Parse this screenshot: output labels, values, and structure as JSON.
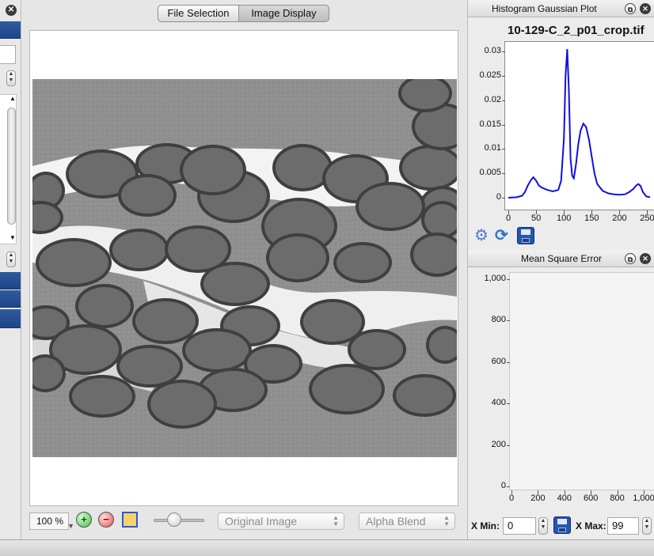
{
  "tabs": {
    "file_selection": "File Selection",
    "image_display": "Image Display"
  },
  "image_controls": {
    "zoom_value": "100 %",
    "display_mode": "Original Image",
    "blend_mode": "Alpha Blend",
    "opacity_slider": 0.4
  },
  "histogram_panel": {
    "header": "Histogram  Gaussian Plot",
    "chart_title": "10-129-C_2_p01_crop.tif"
  },
  "mse_panel": {
    "header": "Mean Square Error",
    "x_min_label": "X Min:",
    "x_min_value": "0",
    "x_max_label": "X Max:",
    "x_max_value": "99"
  },
  "chart_data": [
    {
      "type": "line",
      "title": "10-129-C_2_p01_crop.tif",
      "x_ticks": [
        "0",
        "50",
        "100",
        "150",
        "200",
        "250"
      ],
      "y_ticks": [
        "0",
        "0.005",
        "0.01",
        "0.015",
        "0.02",
        "0.025",
        "0.03"
      ],
      "xlim": [
        0,
        255
      ],
      "ylim": [
        0,
        0.031
      ],
      "series": [
        {
          "color": "#1010e0",
          "x": [
            0,
            15,
            25,
            30,
            35,
            40,
            45,
            50,
            55,
            60,
            70,
            80,
            90,
            95,
            100,
            103,
            106,
            109,
            112,
            115,
            118,
            122,
            126,
            130,
            135,
            140,
            145,
            150,
            155,
            160,
            170,
            180,
            190,
            200,
            210,
            218,
            225,
            230,
            234,
            238,
            242,
            248,
            255
          ],
          "y": [
            0,
            0.0001,
            0.0004,
            0.0012,
            0.0025,
            0.0035,
            0.0042,
            0.0035,
            0.0025,
            0.0021,
            0.0016,
            0.0013,
            0.0016,
            0.0035,
            0.012,
            0.025,
            0.0305,
            0.022,
            0.008,
            0.0045,
            0.004,
            0.007,
            0.011,
            0.0138,
            0.0152,
            0.0145,
            0.012,
            0.0085,
            0.005,
            0.0028,
            0.0014,
            0.0009,
            0.0007,
            0.0006,
            0.0007,
            0.0012,
            0.0018,
            0.0025,
            0.0028,
            0.0024,
            0.0012,
            0.0003,
            0.0001
          ]
        }
      ],
      "grid": false,
      "legend": "none"
    },
    {
      "type": "line",
      "title": "",
      "x_ticks": [
        "0",
        "200",
        "400",
        "600",
        "800",
        "1,000"
      ],
      "y_ticks": [
        "0",
        "200",
        "400",
        "600",
        "800",
        "1,000"
      ],
      "xlim": [
        0,
        1000
      ],
      "ylim": [
        0,
        1000
      ],
      "series": [],
      "grid": false,
      "legend": "none"
    }
  ],
  "icons": {
    "zoom_in": "zoom-in-icon",
    "zoom_out": "zoom-out-icon",
    "fit": "fit-to-window-icon",
    "settings": "gear-icon",
    "refresh": "refresh-icon",
    "save": "save-icon"
  }
}
